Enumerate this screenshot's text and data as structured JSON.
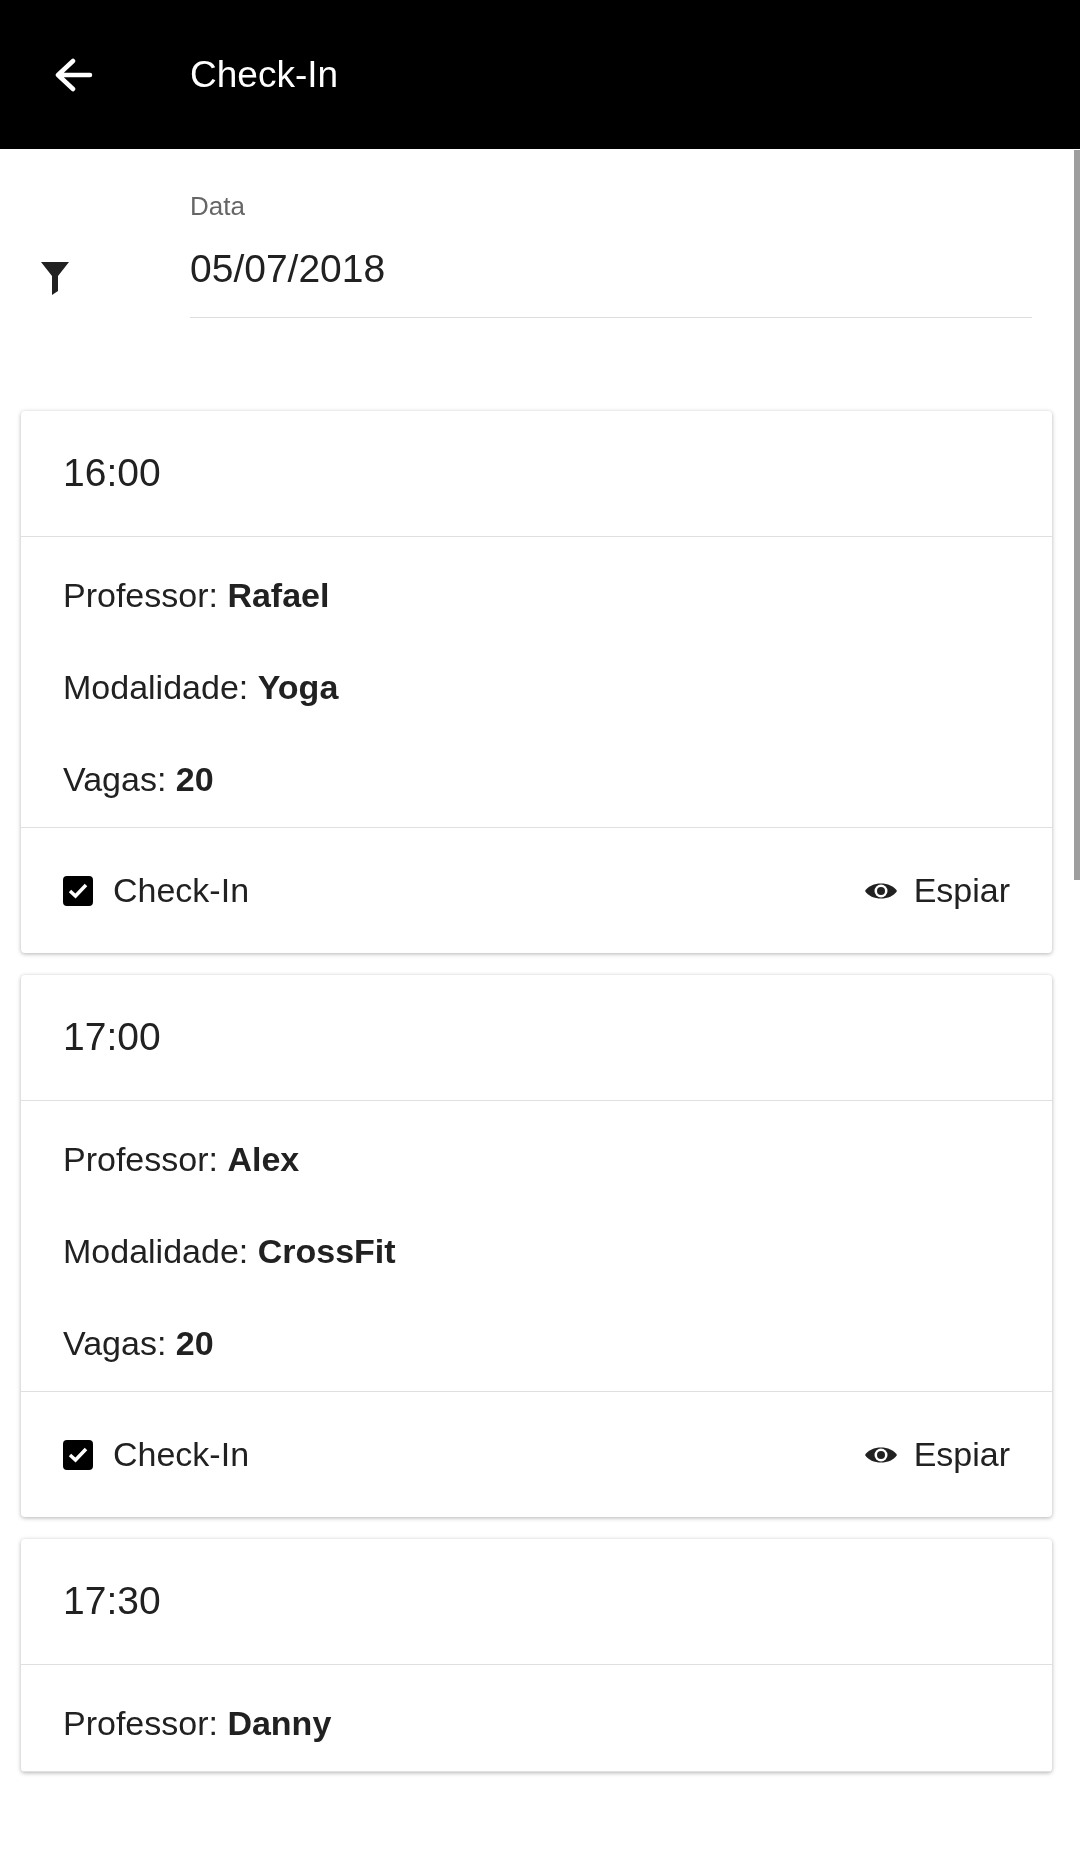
{
  "app_bar": {
    "title": "Check-In"
  },
  "date_filter": {
    "label": "Data",
    "value": "05/07/2018"
  },
  "classes": [
    {
      "time": "16:00",
      "details": [
        "Professor: **Rafael**",
        "Modalidade: **Yoga**",
        "Vagas: **20**"
      ],
      "check_in": {
        "label": "Check-In",
        "checked": true
      },
      "peek_button": "Espiar"
    },
    {
      "time": "17:00",
      "details": [
        "Professor: **Alex**",
        "Modalidade: **CrossFit**",
        "Vagas: **20**"
      ],
      "check_in": {
        "label": "Check-In",
        "checked": true
      },
      "peek_button": "Espiar"
    },
    {
      "time": "17:30",
      "details": [
        "Professor: **Danny**"
      ]
    }
  ]
}
